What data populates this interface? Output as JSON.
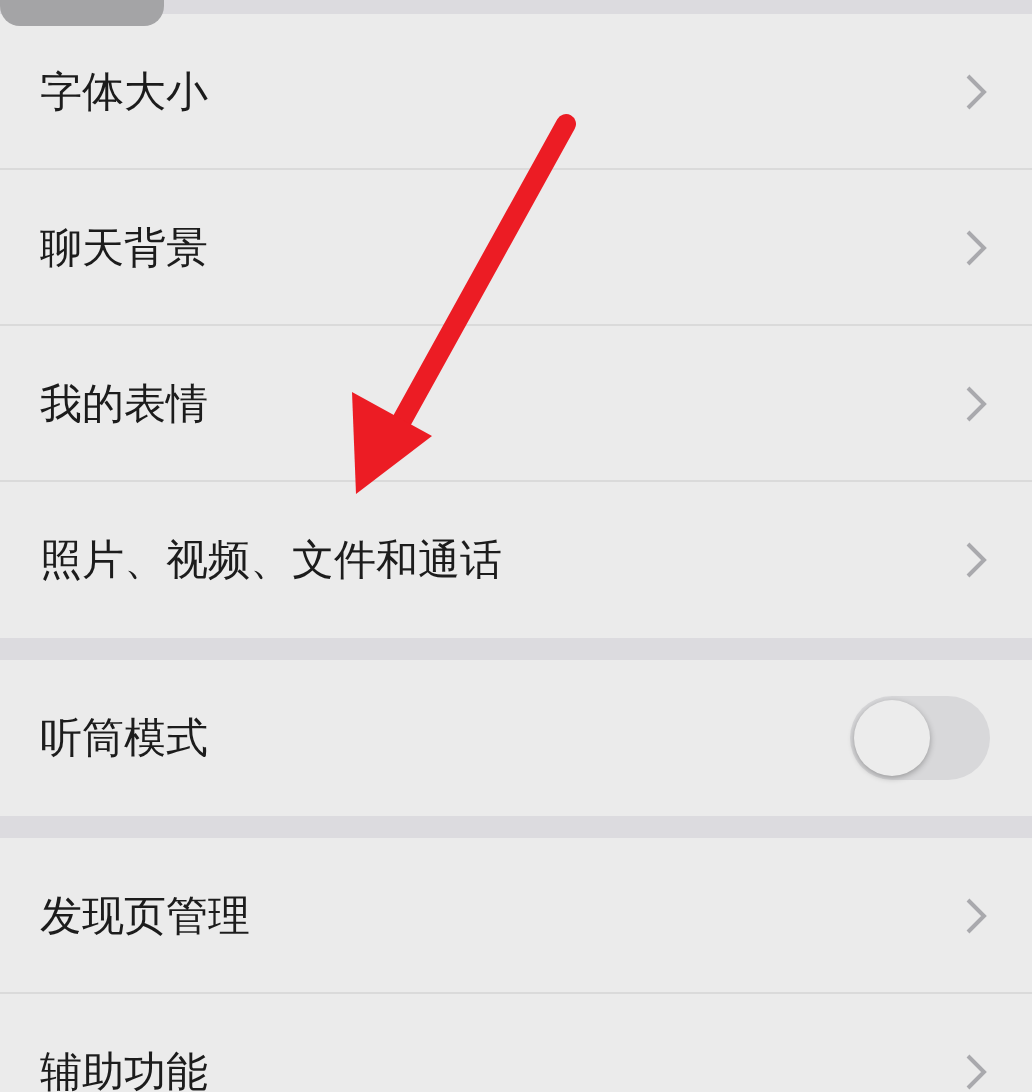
{
  "groups": [
    {
      "rows": [
        {
          "kind": "link",
          "label": "字体大小"
        },
        {
          "kind": "link",
          "label": "聊天背景"
        },
        {
          "kind": "link",
          "label": "我的表情"
        },
        {
          "kind": "link",
          "label": "照片、视频、文件和通话"
        }
      ]
    },
    {
      "rows": [
        {
          "kind": "toggle",
          "label": "听筒模式",
          "on": false
        }
      ]
    },
    {
      "rows": [
        {
          "kind": "link",
          "label": "发现页管理"
        },
        {
          "kind": "link",
          "label": "辅助功能"
        }
      ]
    }
  ]
}
